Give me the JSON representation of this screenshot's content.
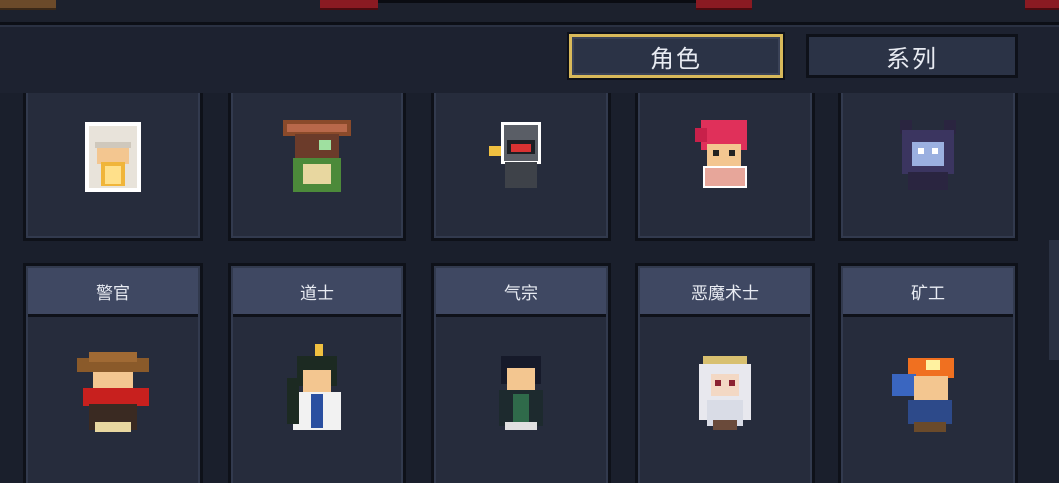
{
  "tabs": [
    {
      "label": "角色",
      "active": true
    },
    {
      "label": "系列",
      "active": false
    }
  ],
  "top_row": [
    {
      "icon": "white-hooded-mage-sprite-icon"
    },
    {
      "icon": "antlered-druid-sprite-icon"
    },
    {
      "icon": "robot-sprite-icon"
    },
    {
      "icon": "red-haired-fighter-sprite-icon"
    },
    {
      "icon": "horned-vampire-sprite-icon"
    }
  ],
  "bottom_row": [
    {
      "name": "警官",
      "icon": "officer-sprite-icon"
    },
    {
      "name": "道士",
      "icon": "taoist-sprite-icon"
    },
    {
      "name": "气宗",
      "icon": "qi-master-sprite-icon"
    },
    {
      "name": "恶魔术士",
      "icon": "demon-warlock-sprite-icon"
    },
    {
      "name": "矿工",
      "icon": "miner-sprite-icon"
    }
  ],
  "colors": {
    "background": "#1a1f2c",
    "card": "#262c3c",
    "name_bar": "#3f4862",
    "active_tab_border": "#d8b95a",
    "accent_red": "#8a1a22"
  }
}
